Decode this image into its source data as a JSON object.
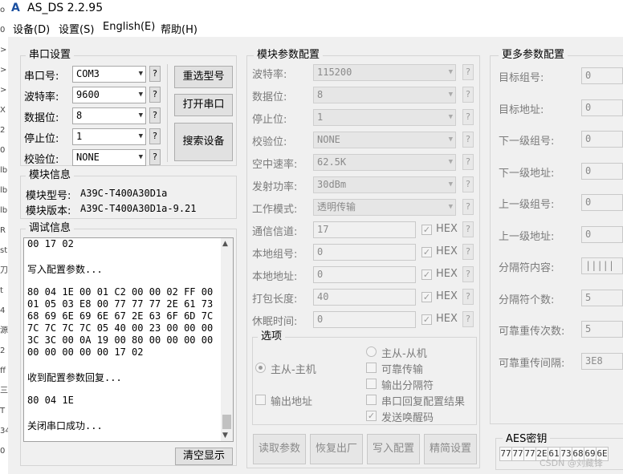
{
  "window": {
    "title": "AS_DS 2.2.95",
    "app_icon": "A"
  },
  "left_strip_text": [
    "o",
    "0",
    ">",
    ">",
    ">",
    "X",
    "2",
    "0",
    "lb",
    "lb",
    "lb",
    "R",
    "st",
    "刀",
    "t",
    "4",
    "源",
    "2",
    "ff",
    "三",
    "T",
    "34",
    "0"
  ],
  "menu": [
    {
      "label": "设备(D)"
    },
    {
      "label": "设置(S)"
    },
    {
      "label": "English(E)"
    },
    {
      "label": "帮助(H)"
    }
  ],
  "serial": {
    "title": "串口设置",
    "rows": [
      {
        "label": "串口号:",
        "value": "COM3"
      },
      {
        "label": "波特率:",
        "value": "9600"
      },
      {
        "label": "数据位:",
        "value": "8"
      },
      {
        "label": "停止位:",
        "value": "1"
      },
      {
        "label": "校验位:",
        "value": "NONE"
      }
    ],
    "help": "?",
    "buttons": {
      "reselect": "重选型号",
      "open_port": "打开串口",
      "search": "搜索设备"
    }
  },
  "module_info": {
    "title": "模块信息",
    "model_label": "模块型号:",
    "model_value": "A39C-T400A30D1a",
    "version_label": "模块版本:",
    "version_value": "A39C-T400A30D1a-9.21"
  },
  "debug": {
    "title": "调试信息",
    "lines": [
      "00 17 02",
      "",
      "写入配置参数...",
      "",
      "80 04 1E 00 01 C2 00 00 02 FF 00",
      "01 05 03 E8 00 77 77 77 2E 61 73",
      "68 69 6E 69 6E 67 2E 63 6F 6D 7C",
      "7C 7C 7C 7C 05 40 00 23 00 00 00",
      "3C 3C 00 0A 19 00 80 00 00 00 00",
      "00 00 00 00 00 17 02",
      "",
      "收到配置参数回复...",
      "",
      "80 04 1E",
      "",
      "关闭串口成功..."
    ],
    "clear_button": "清空显示"
  },
  "module_params": {
    "title": "模块参数配置",
    "combos": [
      {
        "label": "波特率:",
        "value": "115200"
      },
      {
        "label": "数据位:",
        "value": "8"
      },
      {
        "label": "停止位:",
        "value": "1"
      },
      {
        "label": "校验位:",
        "value": "NONE"
      },
      {
        "label": "空中速率:",
        "value": "62.5K"
      },
      {
        "label": "发射功率:",
        "value": "30dBm"
      },
      {
        "label": "工作模式:",
        "value": "透明传输"
      }
    ],
    "hex_fields": [
      {
        "label": "通信信道:",
        "value": "17",
        "hex": "HEX"
      },
      {
        "label": "本地组号:",
        "value": "0",
        "hex": "HEX"
      },
      {
        "label": "本地地址:",
        "value": "0",
        "hex": "HEX"
      },
      {
        "label": "打包长度:",
        "value": "40",
        "hex": "HEX"
      },
      {
        "label": "休眠时间:",
        "value": "0",
        "hex": "HEX"
      }
    ],
    "help": "?",
    "options": {
      "title": "选项",
      "radio_slave": "主从-从机",
      "radio_master": "主从-主机",
      "reliable": "可靠传输",
      "output_separator": "输出分隔符",
      "output_address": "输出地址",
      "serial_reply": "串口回复配置结果",
      "send_wakeup": "发送唤醒码"
    },
    "buttons": {
      "read": "读取参数",
      "restore": "恢复出厂",
      "write": "写入配置",
      "simple": "精简设置"
    }
  },
  "more_params": {
    "title": "更多参数配置",
    "fields": [
      {
        "label": "目标组号:",
        "value": "0"
      },
      {
        "label": "目标地址:",
        "value": "0"
      },
      {
        "label": "下一级组号:",
        "value": "0"
      },
      {
        "label": "下一级地址:",
        "value": "0"
      },
      {
        "label": "上一级组号:",
        "value": "0"
      },
      {
        "label": "上一级地址:",
        "value": "0"
      },
      {
        "label": "分隔符内容:",
        "value": "|||||"
      },
      {
        "label": "分隔符个数:",
        "value": "5"
      },
      {
        "label": "可靠重传次数:",
        "value": "5"
      },
      {
        "label": "可靠重传间隔:",
        "value": "3E8"
      }
    ]
  },
  "aes": {
    "title": "AES密钥",
    "cells": [
      "77",
      "77",
      "77",
      "2E",
      "61",
      "73",
      "68",
      "69",
      "6E"
    ]
  },
  "watermark": "CSDN @刘藏锋"
}
